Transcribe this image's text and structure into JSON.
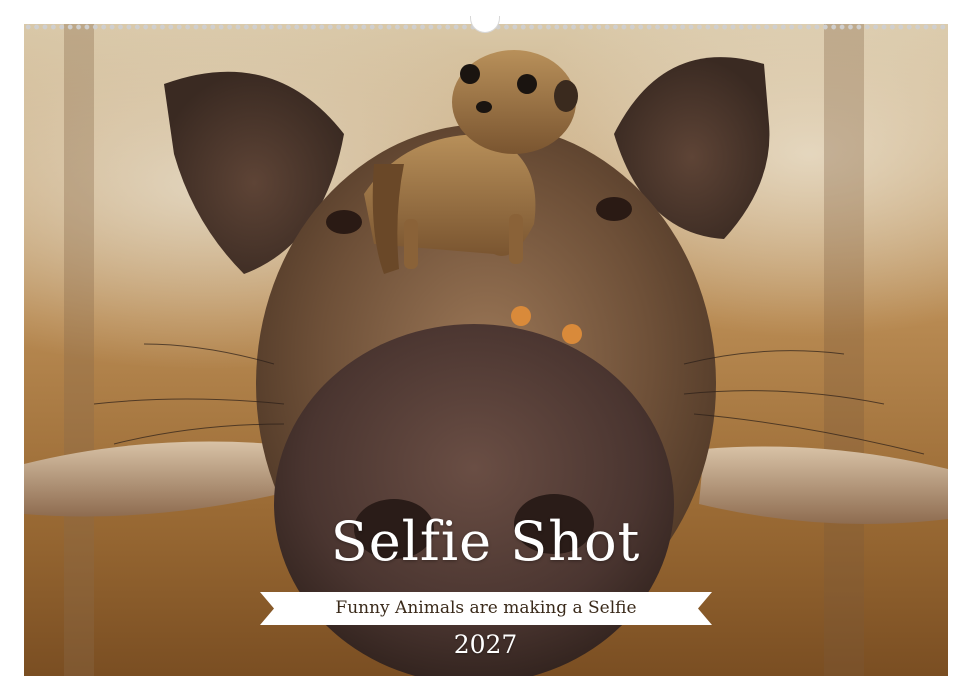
{
  "calendar": {
    "title": "Selfie Shot",
    "subtitle": "Funny Animals are making a Selfie",
    "year": "2027"
  },
  "image": {
    "subject": "meerkat-on-warthog-selfie",
    "colors": {
      "background_light": "#d9c8a8",
      "background_dark": "#7a4e22",
      "fur": "#7a5a40",
      "snout": "#4a3530",
      "tusk": "#b49476",
      "meerkat": "#a07845",
      "banner": "#ffffff",
      "title_text": "#ffffff"
    }
  }
}
